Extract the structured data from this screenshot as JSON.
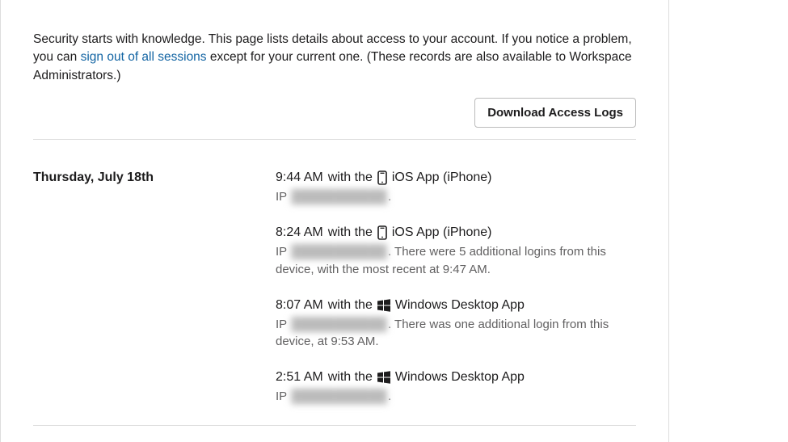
{
  "intro": {
    "pre": "Security starts with knowledge. This page lists details about access to your account. If you notice a problem, you can ",
    "link": "sign out of all sessions",
    "post": " except for your current one. (These records are also available to Workspace Administrators.)"
  },
  "download_label": "Download Access Logs",
  "with_the": " with the ",
  "ip_prefix": "IP ",
  "period": ".",
  "day": {
    "label": "Thursday, July 18th",
    "entries": [
      {
        "time": "9:44 AM",
        "icon": "phone",
        "client": "iOS App (iPhone)",
        "ip_redacted": "███████████",
        "extra": ""
      },
      {
        "time": "8:24 AM",
        "icon": "phone",
        "client": "iOS App (iPhone)",
        "ip_redacted": "███████████",
        "extra": " There were 5 additional logins from this device, with the most recent at 9:47 AM."
      },
      {
        "time": "8:07 AM",
        "icon": "windows",
        "client": "Windows Desktop App",
        "ip_redacted": "███████████",
        "extra": " There was one additional login from this device, at 9:53 AM."
      },
      {
        "time": "2:51 AM",
        "icon": "windows",
        "client": "Windows Desktop App",
        "ip_redacted": "███████████",
        "extra": ""
      }
    ]
  }
}
